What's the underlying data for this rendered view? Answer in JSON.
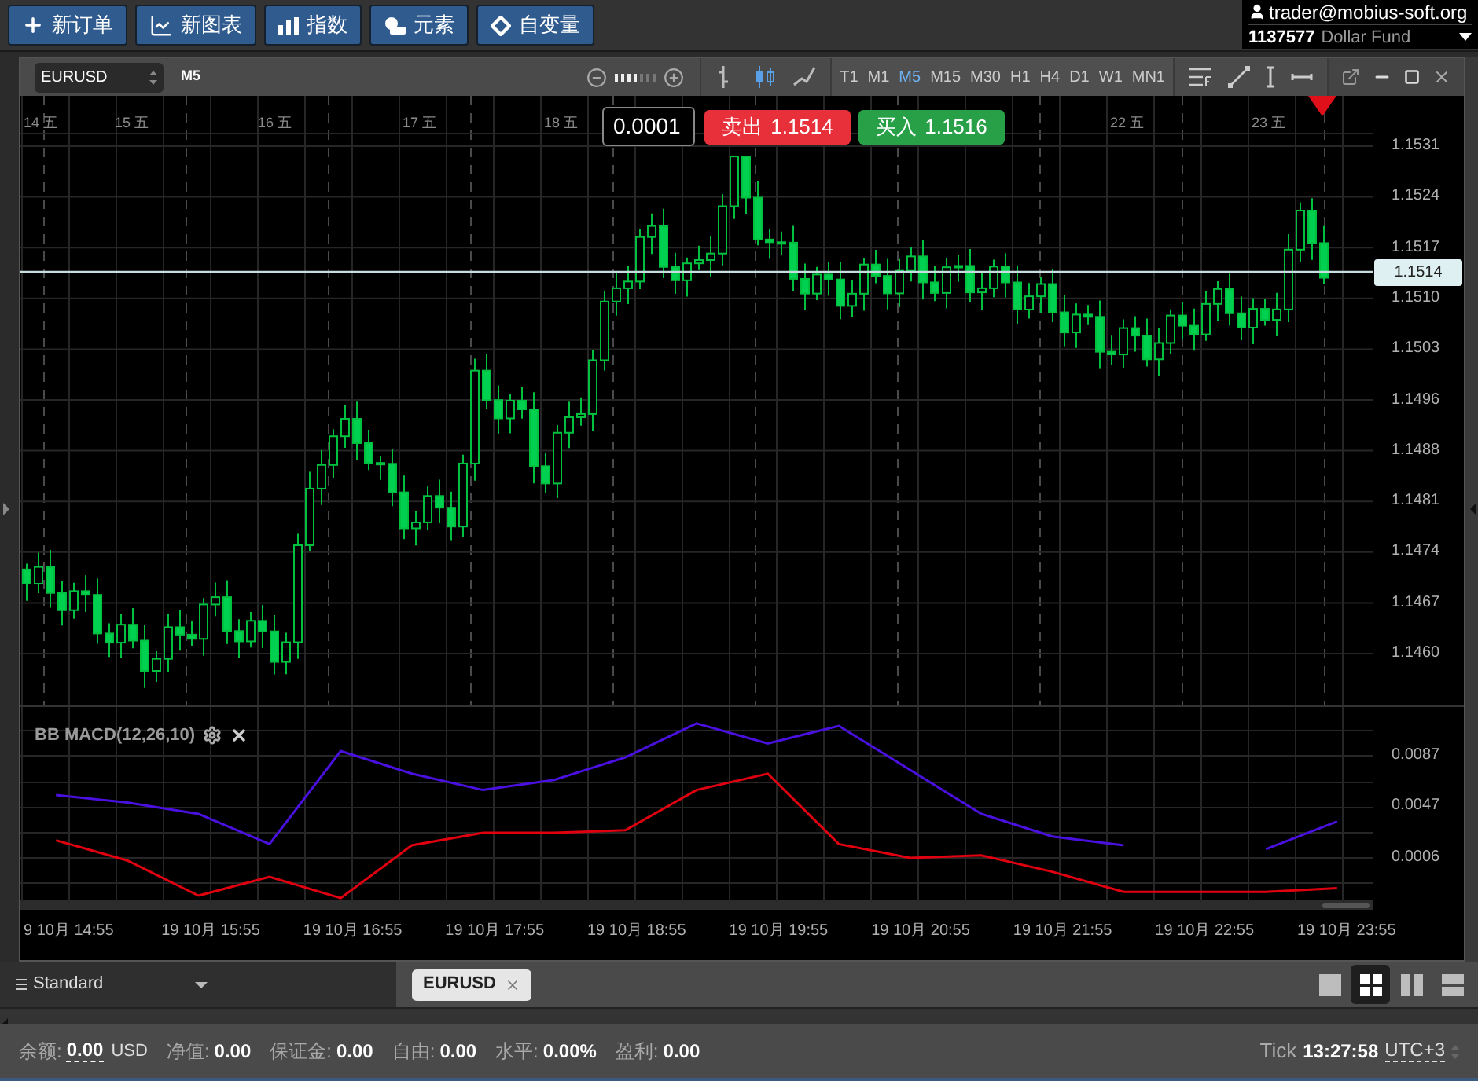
{
  "toolbar": {
    "buttons": [
      {
        "kind": "new-order",
        "label": "新订单"
      },
      {
        "kind": "new-chart",
        "label": "新图表"
      },
      {
        "kind": "indicators",
        "label": "指数"
      },
      {
        "kind": "objects",
        "label": "元素"
      },
      {
        "kind": "variables",
        "label": "自变量"
      }
    ]
  },
  "account": {
    "email": "trader@mobius-soft.org",
    "number": "1137577",
    "name": "Dollar Fund"
  },
  "chart_window": {
    "symbol": "EURUSD",
    "period": "M5",
    "zoom": {
      "level": 0.57
    },
    "chart_types": [
      {
        "kind": "bar",
        "selected": false
      },
      {
        "kind": "candle",
        "selected": true
      },
      {
        "kind": "line",
        "selected": false
      }
    ],
    "timeframes": [
      {
        "label": "T1",
        "selected": false
      },
      {
        "label": "M1",
        "selected": false
      },
      {
        "label": "M5",
        "selected": true
      },
      {
        "label": "M15",
        "selected": false
      },
      {
        "label": "M30",
        "selected": false
      },
      {
        "label": "H1",
        "selected": false
      },
      {
        "label": "H4",
        "selected": false
      },
      {
        "label": "D1",
        "selected": false
      },
      {
        "label": "W1",
        "selected": false
      },
      {
        "label": "MN1",
        "selected": false
      }
    ],
    "date_labels": [
      "14 五",
      "15 五",
      "16 五",
      "17 五",
      "18 五",
      "22 五",
      "23 五"
    ],
    "spread": "0.0001",
    "sell": {
      "label": "卖出",
      "price": "1.1514"
    },
    "buy": {
      "label": "买入",
      "price": "1.1516"
    },
    "price_axis": [
      "1.1531",
      "1.1524",
      "1.1517",
      "1.1510",
      "1.1503",
      "1.1496",
      "1.1488",
      "1.1481",
      "1.1474",
      "1.1467",
      "1.1460"
    ],
    "current_price": "1.1514",
    "indicator": {
      "chart_data": {
        "type": "line",
        "title": "BB MACD(12,26,10)",
        "yticks": [
          {
            "value": 0.0087,
            "label": "0.0087"
          },
          {
            "value": 0.0047,
            "label": "0.0047"
          },
          {
            "value": 0.0006,
            "label": "0.0006"
          }
        ],
        "series": [
          {
            "color": "#4a10e0",
            "values": [
              0.0056,
              0.005,
              0.0041,
              0.0017,
              0.0091,
              0.0073,
              0.006,
              0.0068,
              0.0086,
              0.0113,
              0.0097,
              0.0111,
              0.0076,
              0.0041,
              0.0023,
              0.0016,
              null,
              0.0013,
              0.0035
            ]
          },
          {
            "color": "#e00010",
            "values": [
              0.002,
              0.0004,
              -0.0024,
              -0.0009,
              -0.0026,
              0.0016,
              0.0026,
              0.0026,
              0.0028,
              0.006,
              0.0073,
              0.0017,
              0.0006,
              0.0008,
              -0.0005,
              -0.0021,
              -0.0021,
              -0.0021,
              -0.0018
            ]
          }
        ],
        "ylim": [
          -0.0029,
          0.0126
        ],
        "grid": true
      }
    },
    "time_axis": [
      "9 10月 14:55",
      "19 10月 15:55",
      "19 10月 16:55",
      "19 10月 17:55",
      "19 10月 18:55",
      "19 10月 19:55",
      "19 10月 20:55",
      "19 10月 21:55",
      "19 10月 22:55",
      "19 10月 23:55"
    ]
  },
  "bottom_panel": {
    "workspace": "Standard",
    "tabs": [
      {
        "label": "EURUSD",
        "selected": true
      }
    ],
    "layouts": [
      {
        "kind": "single",
        "selected": false
      },
      {
        "kind": "grid",
        "selected": true
      },
      {
        "kind": "columns",
        "selected": false
      },
      {
        "kind": "rows",
        "selected": false
      }
    ]
  },
  "status_bar": {
    "items": [
      {
        "label": "余额:",
        "value": "0.00",
        "unit": "USD"
      },
      {
        "label": "净值:",
        "value": "0.00"
      },
      {
        "label": "保证金:",
        "value": "0.00"
      },
      {
        "label": "自由:",
        "value": "0.00"
      },
      {
        "label": "水平:",
        "value": "0.00%"
      },
      {
        "label": "盈利:",
        "value": "0.00"
      }
    ],
    "mode": "Tick",
    "time": "13:27:58",
    "timezone": "UTC+3"
  }
}
